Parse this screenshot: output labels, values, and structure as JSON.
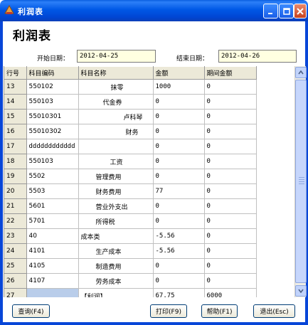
{
  "window": {
    "title": "利润表"
  },
  "heading": "利润表",
  "dates": {
    "start_label": "开始日期：",
    "start_value": "2012-04-25",
    "end_label": "结束日期：",
    "end_value": "2012-04-26"
  },
  "grid": {
    "columns": [
      "行号",
      "科目编码",
      "科目名称",
      "金额",
      "期间金额"
    ],
    "rows": [
      {
        "no": "13",
        "code": "550102",
        "name": "抹零",
        "amount": "1000",
        "period": "0"
      },
      {
        "no": "14",
        "code": "550103",
        "name": "代金券",
        "amount": "0",
        "period": "0"
      },
      {
        "no": "15",
        "code": "55010301",
        "name": "卢科琴",
        "amount": "0",
        "period": "0"
      },
      {
        "no": "16",
        "code": "55010302",
        "name": "财务",
        "amount": "0",
        "period": "0"
      },
      {
        "no": "17",
        "code": "dddddddddddd",
        "name": "",
        "amount": "0",
        "period": "0"
      },
      {
        "no": "18",
        "code": "550103",
        "name": "工资",
        "amount": "0",
        "period": "0"
      },
      {
        "no": "19",
        "code": "5502",
        "name": "管理费用",
        "amount": "0",
        "period": "0"
      },
      {
        "no": "20",
        "code": "5503",
        "name": "财务费用",
        "amount": "77",
        "period": "0"
      },
      {
        "no": "21",
        "code": "5601",
        "name": "营业外支出",
        "amount": "0",
        "period": "0"
      },
      {
        "no": "22",
        "code": "5701",
        "name": "所得税",
        "amount": "0",
        "period": "0"
      },
      {
        "no": "23",
        "code": "40",
        "name": "成本类",
        "amount": "-5.56",
        "period": "0"
      },
      {
        "no": "24",
        "code": "4101",
        "name": "生产成本",
        "amount": "-5.56",
        "period": "0"
      },
      {
        "no": "25",
        "code": "4105",
        "name": "制造费用",
        "amount": "0",
        "period": "0"
      },
      {
        "no": "26",
        "code": "4107",
        "name": "劳务成本",
        "amount": "0",
        "period": "0"
      },
      {
        "no": "27",
        "code": "",
        "name": "【利润】",
        "amount": "67.75",
        "period": "6000"
      }
    ]
  },
  "buttons": {
    "query": "查询(F4)",
    "print": "打印(F9)",
    "help": "帮助(F1)",
    "exit": "退出(Esc)"
  },
  "colors": {
    "titlebar": "#0058e6",
    "date_field_bg": "#ffffe1",
    "header_bg": "#ece9d8",
    "selected_cell": "#b9cdea"
  }
}
